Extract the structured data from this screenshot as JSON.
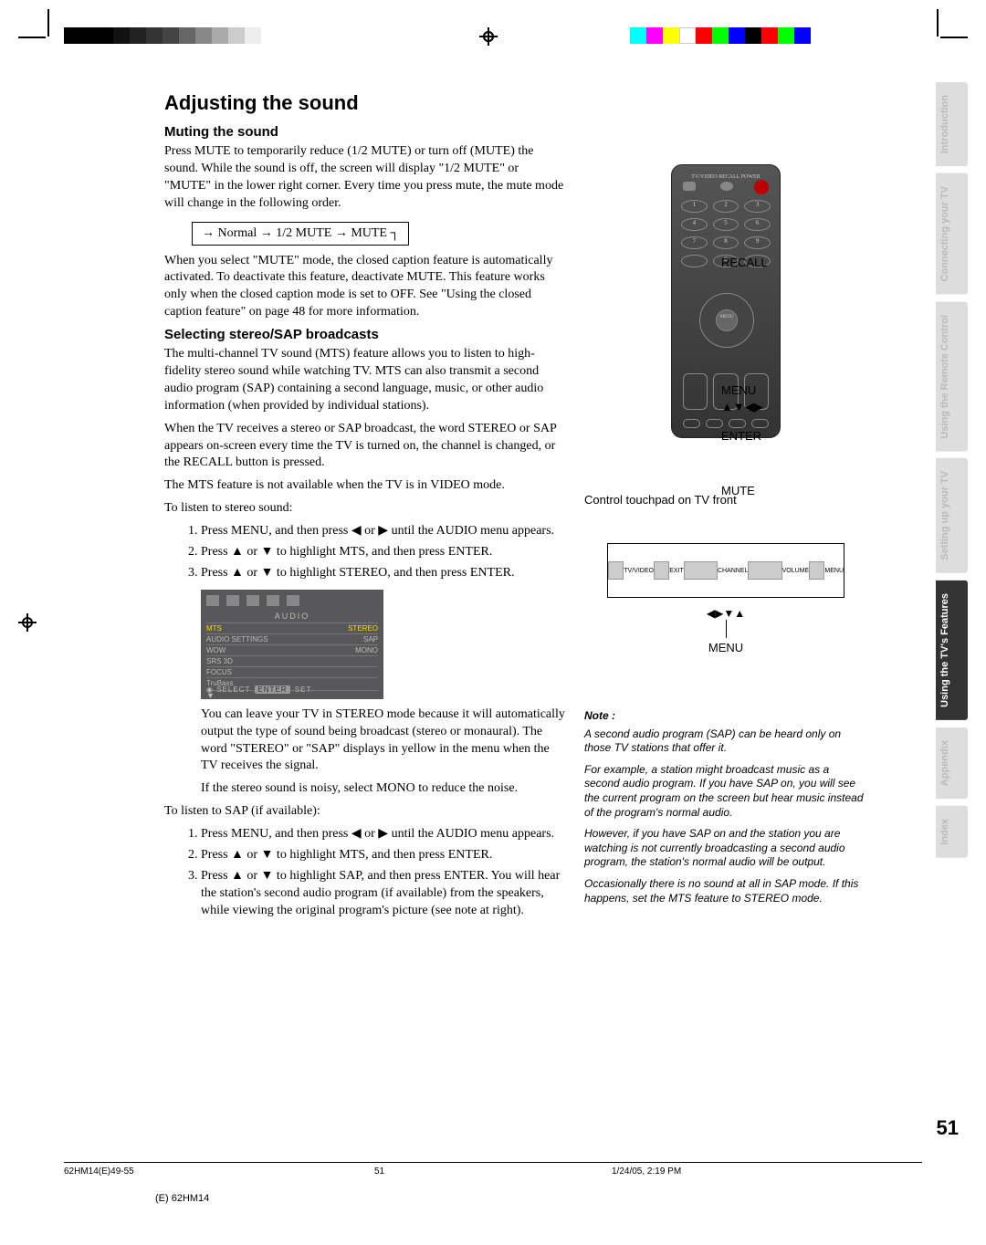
{
  "page_title": "Adjusting the sound",
  "muting": {
    "heading": "Muting the sound",
    "p1": "Press MUTE to temporarily reduce (1/2 MUTE) or turn off (MUTE) the sound. While the sound is off, the screen will display \"1/2 MUTE\" or \"MUTE\" in the lower right corner. Every time you press mute, the mute mode will change in the following order.",
    "flow": "→ Normal → 1/2 MUTE → MUTE  ┐",
    "p2": "When you select \"MUTE\" mode, the closed caption feature is automatically activated. To deactivate this feature, deactivate MUTE. This feature works only when the closed caption mode is set to OFF. See \"Using the closed caption feature\" on page 48 for more information."
  },
  "stereo": {
    "heading": "Selecting stereo/SAP broadcasts",
    "p1": "The multi-channel TV sound (MTS) feature allows you to listen to high-fidelity stereo sound while watching TV. MTS can also transmit a second audio program (SAP) containing a second language, music, or other audio information (when provided by individual stations).",
    "p2": "When the TV receives a stereo or SAP broadcast, the word STEREO or SAP appears on-screen every time the TV is turned on, the channel is changed, or the RECALL button is pressed.",
    "p3": "The MTS feature is not available when the TV is in VIDEO mode.",
    "listen_stereo": "To listen to stereo sound:",
    "steps_stereo": [
      "Press MENU, and then press ◀ or ▶ until the AUDIO menu appears.",
      "Press ▲ or ▼ to highlight MTS, and then press ENTER.",
      "Press ▲ or ▼ to highlight STEREO, and then press ENTER."
    ],
    "after1": "You can leave your TV in STEREO mode because it will automatically output the type of sound being broadcast (stereo or monaural). The word \"STEREO\" or \"SAP\" displays in yellow in the menu when the TV receives the signal.",
    "after2": "If the stereo sound is noisy, select MONO to reduce the noise.",
    "listen_sap": "To listen to SAP (if available):",
    "steps_sap": [
      "Press MENU, and then press ◀ or ▶ until the AUDIO menu appears.",
      "Press ▲ or ▼ to highlight MTS, and then press ENTER.",
      "Press ▲ or ▼ to highlight SAP, and then press ENTER. You will hear the station's second audio program (if available) from the speakers, while viewing the original program's picture (see note at right)."
    ]
  },
  "remote_labels": {
    "recall": "RECALL",
    "menu": "MENU",
    "arrows": "▲▼◀▶",
    "enter": "ENTER",
    "mute": "MUTE"
  },
  "touchpad_caption": "Control touchpad on TV front",
  "touchpad_buttons": [
    "TV/VIDEO",
    "EXIT",
    "CHANNEL",
    "VOLUME",
    "MENU"
  ],
  "touchpad_arrows": "◀▶▼▲",
  "touchpad_menu_label": "MENU",
  "note": {
    "title": "Note :",
    "p1": "A second audio program (SAP) can be heard only on those TV stations that offer it.",
    "p2": "For example, a station might broadcast music as a second audio program. If you have SAP on, you will see the current program on the screen but hear music instead of the program's normal audio.",
    "p3": "However, if you have SAP on and the station you are watching is not currently broadcasting a second audio program, the station's normal audio will be output.",
    "p4": "Occasionally there is no sound at all in SAP mode. If this happens, set the MTS feature to STEREO mode."
  },
  "menu_screenshot": {
    "title": "AUDIO",
    "rows": [
      {
        "l": "MTS",
        "r": "STEREO",
        "sel": true
      },
      {
        "l": "AUDIO SETTINGS",
        "r": "SAP"
      },
      {
        "l": "WOW",
        "r": "MONO"
      },
      {
        "l": "  SRS 3D",
        "r": ""
      },
      {
        "l": "  FOCUS",
        "r": ""
      },
      {
        "l": "  TruBass",
        "r": ""
      }
    ],
    "footer_select": "SELECT",
    "footer_enter": "ENTER",
    "footer_set": "SET"
  },
  "tabs": [
    "Introduction",
    "Connecting your TV",
    "Using the Remote Control",
    "Setting up your TV",
    "Using the TV's Features",
    "Appendix",
    "Index"
  ],
  "active_tab_index": 4,
  "page_number": "51",
  "footer": {
    "left": "62HM14(E)49-55",
    "mid": "51",
    "right": "1/24/05, 2:19 PM",
    "model": "(E) 62HM14"
  }
}
